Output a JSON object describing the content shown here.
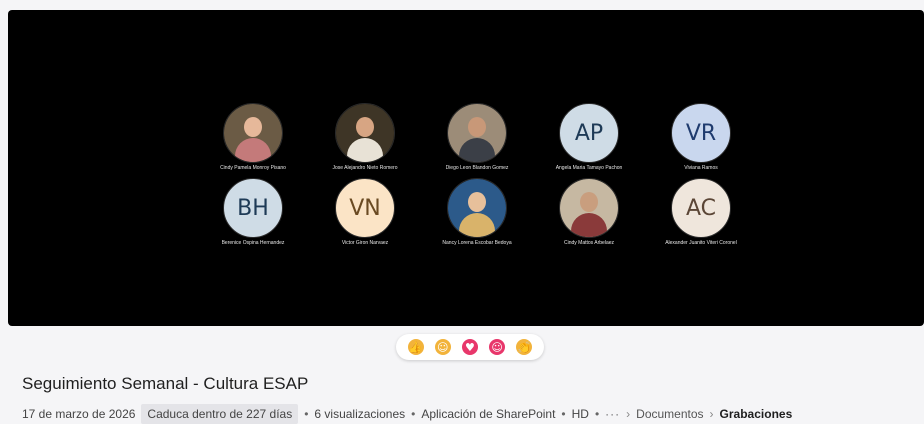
{
  "participants": [
    {
      "name": "Cindy Pamela Monroy Pisano",
      "type": "photo",
      "bg": "#6b5b45",
      "skin": "#e6b89a",
      "cloth": "#c47a7a"
    },
    {
      "name": "Jose Alejandro Nieto Romero",
      "type": "photo",
      "bg": "#3e3526",
      "skin": "#d7a583",
      "cloth": "#e8e2d6"
    },
    {
      "name": "Diego Leon Blandon Gomez",
      "type": "photo",
      "bg": "#9c8c78",
      "skin": "#c89878",
      "cloth": "#3b3f47"
    },
    {
      "name": "Angela Maria Tamayo Pachon",
      "type": "initials",
      "initials": "AP",
      "bg": "#cfdce6",
      "fg": "#1e3a56"
    },
    {
      "name": "Viviana Ramos",
      "type": "initials",
      "initials": "VR",
      "bg": "#c9d7ee",
      "fg": "#1f3b6e"
    },
    {
      "name": "Berenice Ospina Hernandez",
      "type": "initials",
      "initials": "BH",
      "bg": "#cfdce6",
      "fg": "#1e3a56"
    },
    {
      "name": "Victor Giron Narvaez",
      "type": "initials",
      "initials": "VN",
      "bg": "#fbe4c6",
      "fg": "#6a4a22"
    },
    {
      "name": "Nancy Lorena Escobar Bedoya",
      "type": "photo",
      "bg": "#2c5a8a",
      "skin": "#e7c09b",
      "cloth": "#d9b36a"
    },
    {
      "name": "Cindy Mattos Arbelaez",
      "type": "photo",
      "bg": "#c6b8a2",
      "skin": "#c99e7e",
      "cloth": "#8a3a3a"
    },
    {
      "name": "Alexander Juanito Viteri Coronel",
      "type": "initials",
      "initials": "AC",
      "bg": "#efe6dc",
      "fg": "#5b4636"
    }
  ],
  "reactions": [
    {
      "icon": "thumbs-up-icon",
      "glyph": "👍",
      "color": "#f2b33b"
    },
    {
      "icon": "laugh-icon",
      "glyph": "☺",
      "color": "#f2b33b"
    },
    {
      "icon": "heart-icon",
      "glyph": "♥",
      "color": "#e8376b"
    },
    {
      "icon": "surprised-icon",
      "glyph": "☺",
      "color": "#e8376b"
    },
    {
      "icon": "applause-icon",
      "glyph": "👏",
      "color": "#f2b33b"
    }
  ],
  "title": "Seguimiento Semanal - Cultura ESAP",
  "meta": {
    "date": "17 de marzo de 2026",
    "expires": "Caduca dentro de 227 días",
    "views": "6 visualizaciones",
    "app": "Aplicación de SharePoint",
    "quality": "HD",
    "more": "···",
    "breadcrumb": [
      "Documentos",
      "Grabaciones"
    ]
  }
}
